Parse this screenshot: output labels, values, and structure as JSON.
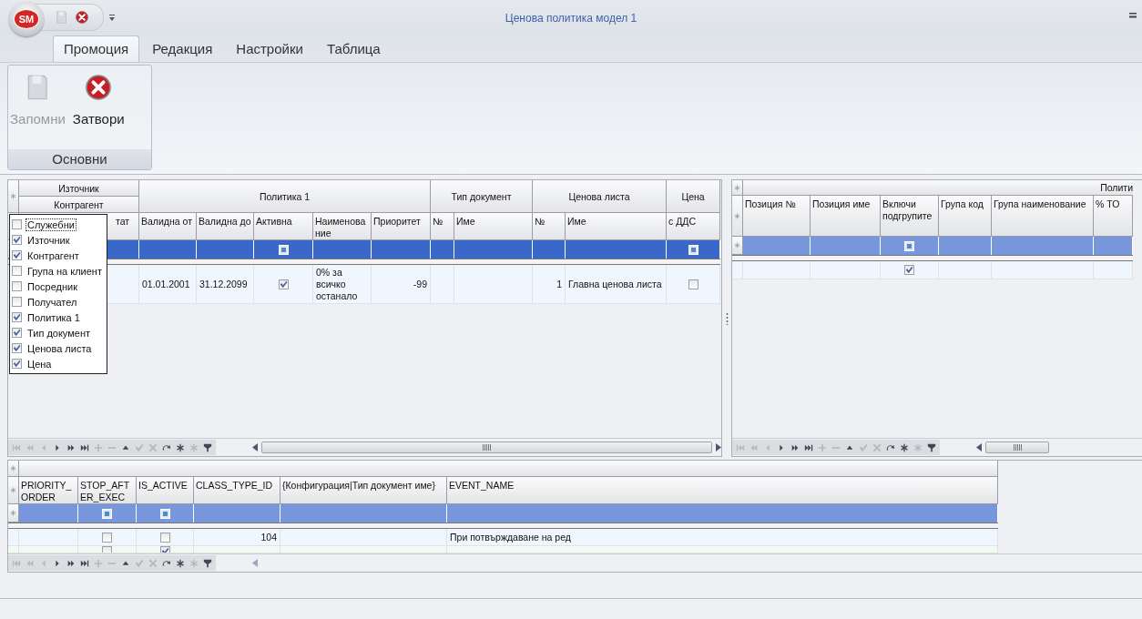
{
  "window": {
    "logo": "SM",
    "title": "Ценова политика модел 1"
  },
  "quick_access": [
    {
      "kind": "save",
      "disabled": true
    },
    {
      "kind": "close",
      "disabled": false
    }
  ],
  "ribbon": {
    "tabs": [
      {
        "label": "Промоция",
        "selected": true
      },
      {
        "label": "Редакция",
        "selected": false
      },
      {
        "label": "Настройки",
        "selected": false
      },
      {
        "label": "Таблица",
        "selected": false
      }
    ],
    "groups": [
      {
        "label": "Основни",
        "buttons": [
          {
            "kind": "save",
            "label": "Запомни",
            "disabled": true
          },
          {
            "kind": "close",
            "label": "Затвори",
            "disabled": false
          }
        ]
      }
    ]
  },
  "grids": [
    {
      "focused": true,
      "bands": [
        {
          "labels": [
            "Източник",
            "Контрагент"
          ]
        },
        {
          "labels": [
            "Политика 1"
          ]
        },
        {
          "labels": [
            "Тип документ"
          ]
        },
        {
          "labels": [
            "Ценова листа"
          ]
        },
        {
          "labels": [
            "Цена"
          ]
        }
      ],
      "columns": [
        {
          "label": "тат",
          "kind": "text"
        },
        {
          "label": "Валидна от",
          "kind": "text"
        },
        {
          "label": "Валидна до",
          "kind": "text"
        },
        {
          "label": "Активна",
          "kind": "check"
        },
        {
          "label": "Наименование",
          "kind": "text"
        },
        {
          "label": "Приоритет",
          "kind": "text"
        },
        {
          "label": "№",
          "kind": "text"
        },
        {
          "label": "Име",
          "kind": "text"
        },
        {
          "label": "№",
          "kind": "text"
        },
        {
          "label": "Име",
          "kind": "text"
        },
        {
          "label": "с ДДС",
          "kind": "check"
        }
      ],
      "rows": [
        {
          "cells": [
            {},
            {
              "text": "01.01.2001"
            },
            {
              "text": "31.12.2099"
            },
            {
              "checked": true
            },
            {
              "text": "0% за всичко останало"
            },
            {
              "text": "-99"
            },
            {},
            {},
            {
              "text": "1"
            },
            {
              "text": "Главна ценова листа"
            },
            {
              "checked": false
            }
          ]
        }
      ],
      "navigator": [
        {
          "disabled": true
        },
        {
          "disabled": true
        },
        {
          "disabled": true
        },
        {
          "disabled": false
        },
        {
          "disabled": false
        },
        {
          "disabled": false
        },
        {
          "disabled": true
        },
        {
          "disabled": true
        },
        {
          "disabled": false
        },
        {
          "disabled": true
        },
        {
          "disabled": true
        },
        {
          "disabled": false
        },
        {
          "disabled": false
        },
        {
          "disabled": true
        },
        {
          "disabled": false
        }
      ]
    },
    {
      "focused": false,
      "bands": [
        {
          "labels": [
            "Полити"
          ]
        }
      ],
      "columns": [
        {
          "label": "Позиция №",
          "kind": "text"
        },
        {
          "label": "Позиция име",
          "kind": "text"
        },
        {
          "label": "Включи подгрупите",
          "kind": "check"
        },
        {
          "label": "Група код",
          "kind": "text"
        },
        {
          "label": "Група наименование",
          "kind": "text"
        },
        {
          "label": "% ТО",
          "kind": "text"
        }
      ],
      "rows": [
        {
          "cells": [
            {},
            {},
            {
              "checked": true
            },
            {},
            {},
            {}
          ]
        }
      ],
      "navigator": [
        {
          "disabled": true
        },
        {
          "disabled": true
        },
        {
          "disabled": true
        },
        {
          "disabled": false
        },
        {
          "disabled": false
        },
        {
          "disabled": false
        },
        {
          "disabled": true
        },
        {
          "disabled": true
        },
        {
          "disabled": false
        },
        {
          "disabled": true
        },
        {
          "disabled": true
        },
        {
          "disabled": false
        },
        {
          "disabled": false
        },
        {
          "disabled": true
        },
        {
          "disabled": false
        }
      ]
    },
    {
      "focused": false,
      "columns": [
        {
          "label": "PRIORITY_ORDER",
          "kind": "text"
        },
        {
          "label": "STOP_AFTER_EXEC",
          "kind": "check"
        },
        {
          "label": "IS_ACTIVE",
          "kind": "check"
        },
        {
          "label": "CLASS_TYPE_ID",
          "kind": "text"
        },
        {
          "label": "{Конфигурация|Тип документ име}",
          "kind": "text"
        },
        {
          "label": "EVENT_NAME",
          "kind": "text"
        }
      ],
      "rows": [
        {
          "cells": [
            {},
            {
              "checked": false
            },
            {
              "checked": false
            },
            {
              "text": "104"
            },
            {},
            {
              "text": "При потвърждаване на ред"
            }
          ]
        },
        {
          "cells": [
            {},
            {
              "checked": false
            },
            {
              "checked": true
            },
            {},
            {},
            {}
          ]
        }
      ],
      "navigator": [
        {
          "disabled": true
        },
        {
          "disabled": true
        },
        {
          "disabled": true
        },
        {
          "disabled": false
        },
        {
          "disabled": false
        },
        {
          "disabled": false
        },
        {
          "disabled": true
        },
        {
          "disabled": true
        },
        {
          "disabled": false
        },
        {
          "disabled": true
        },
        {
          "disabled": true
        },
        {
          "disabled": false
        },
        {
          "disabled": false
        },
        {
          "disabled": true
        },
        {
          "disabled": false
        }
      ]
    }
  ],
  "column_chooser": {
    "items": [
      {
        "label": "Служебни",
        "checked": false
      },
      {
        "label": "Източник",
        "checked": true
      },
      {
        "label": "Контрагент",
        "checked": true
      },
      {
        "label": "Група на клиент",
        "checked": false
      },
      {
        "label": "Посредник",
        "checked": false
      },
      {
        "label": "Получател",
        "checked": false
      },
      {
        "label": "Политика 1",
        "checked": true
      },
      {
        "label": "Тип документ",
        "checked": true
      },
      {
        "label": "Ценова листа",
        "checked": true
      },
      {
        "label": "Цена",
        "checked": true
      }
    ]
  }
}
